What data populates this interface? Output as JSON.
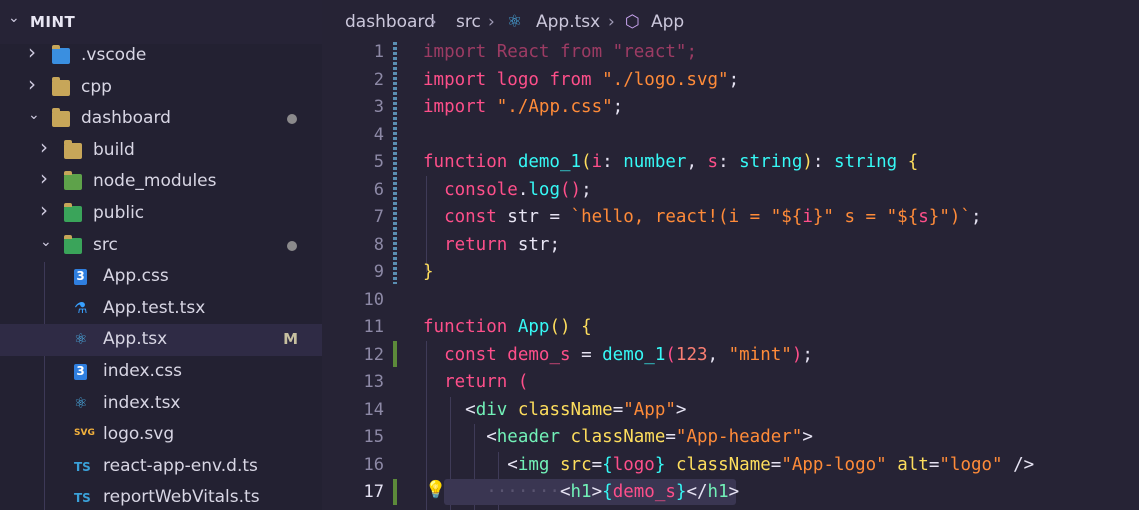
{
  "explorer": {
    "root_label": "MINT",
    "items": [
      {
        "label": ".vscode",
        "depth": 1,
        "expanded": false,
        "icon": "vscode-folder-icon"
      },
      {
        "label": "cpp",
        "depth": 1,
        "expanded": false,
        "icon": "folder-icon"
      },
      {
        "label": "dashboard",
        "depth": 1,
        "expanded": true,
        "icon": "folder-open-icon",
        "badge": "dot"
      },
      {
        "label": "build",
        "depth": 2,
        "expanded": false,
        "icon": "build-folder-icon"
      },
      {
        "label": "node_modules",
        "depth": 2,
        "expanded": false,
        "icon": "node-folder-icon"
      },
      {
        "label": "public",
        "depth": 2,
        "expanded": false,
        "icon": "public-folder-icon"
      },
      {
        "label": "src",
        "depth": 2,
        "expanded": true,
        "icon": "src-folder-icon",
        "badge": "dot"
      },
      {
        "label": "App.css",
        "depth": 3,
        "icon": "css-icon"
      },
      {
        "label": "App.test.tsx",
        "depth": 3,
        "icon": "test-icon"
      },
      {
        "label": "App.tsx",
        "depth": 3,
        "icon": "react-icon",
        "selected": true,
        "status": "M"
      },
      {
        "label": "index.css",
        "depth": 3,
        "icon": "css-icon"
      },
      {
        "label": "index.tsx",
        "depth": 3,
        "icon": "react-icon"
      },
      {
        "label": "logo.svg",
        "depth": 3,
        "icon": "svg-icon"
      },
      {
        "label": "react-app-env.d.ts",
        "depth": 3,
        "icon": "ts-icon"
      },
      {
        "label": "reportWebVitals.ts",
        "depth": 3,
        "icon": "ts-icon"
      }
    ]
  },
  "breadcrumb": {
    "parts": [
      "dashboard",
      "src",
      "App.tsx",
      "App"
    ]
  },
  "editor": {
    "line_numbers": [
      "1",
      "2",
      "3",
      "4",
      "5",
      "6",
      "7",
      "8",
      "9",
      "10",
      "11",
      "12",
      "13",
      "14",
      "15",
      "16",
      "17"
    ],
    "active_line": "17",
    "lines": [
      [
        [
          "imp",
          "import "
        ],
        [
          "imp",
          "React "
        ],
        [
          "imp",
          "from "
        ],
        [
          "imp",
          "\"react\""
        ],
        [
          "imp",
          ";"
        ]
      ],
      [
        [
          "kw2",
          "import "
        ],
        [
          "typ",
          "logo "
        ],
        [
          "kw2",
          "from "
        ],
        [
          "str",
          "\"./logo.svg\""
        ],
        [
          "pl",
          ";"
        ]
      ],
      [
        [
          "kw2",
          "import "
        ],
        [
          "str",
          "\"./App.css\""
        ],
        [
          "pl",
          ";"
        ]
      ],
      [],
      [
        [
          "kw2",
          "function "
        ],
        [
          "fn",
          "demo_1"
        ],
        [
          "brace",
          "("
        ],
        [
          "typ",
          "i"
        ],
        [
          "pl",
          ": "
        ],
        [
          "fn",
          "number"
        ],
        [
          "pl",
          ", "
        ],
        [
          "typ",
          "s"
        ],
        [
          "pl",
          ": "
        ],
        [
          "fn",
          "string"
        ],
        [
          "brace",
          ")"
        ],
        [
          "pl",
          ": "
        ],
        [
          "fn",
          "string "
        ],
        [
          "brace",
          "{"
        ]
      ],
      [
        [
          "pl",
          "  "
        ],
        [
          "kw2",
          "console"
        ],
        [
          "pl",
          "."
        ],
        [
          "fn",
          "log"
        ],
        [
          "brace2",
          "()"
        ],
        [
          "pl",
          ";"
        ]
      ],
      [
        [
          "pl",
          "  "
        ],
        [
          "kw2",
          "const "
        ],
        [
          "var",
          "str "
        ],
        [
          "pl",
          "= "
        ],
        [
          "str",
          "`hello, react!(i = \"${"
        ],
        [
          "kw2",
          "i"
        ],
        [
          "str",
          "}\" s = \"${"
        ],
        [
          "kw2",
          "s"
        ],
        [
          "str",
          "}\")`"
        ],
        [
          "pl",
          ";"
        ]
      ],
      [
        [
          "pl",
          "  "
        ],
        [
          "kw2",
          "return "
        ],
        [
          "var",
          "str"
        ],
        [
          "pl",
          ";"
        ]
      ],
      [
        [
          "brace",
          "}"
        ]
      ],
      [],
      [
        [
          "kw2",
          "function "
        ],
        [
          "fn",
          "App"
        ],
        [
          "brace",
          "()"
        ],
        [
          "pl",
          " "
        ],
        [
          "brace",
          "{"
        ]
      ],
      [
        [
          "pl",
          "  "
        ],
        [
          "kw2",
          "const "
        ],
        [
          "typ",
          "demo_s "
        ],
        [
          "pl",
          "= "
        ],
        [
          "fn",
          "demo_1"
        ],
        [
          "brace2",
          "("
        ],
        [
          "num",
          "123"
        ],
        [
          "pl",
          ", "
        ],
        [
          "str",
          "\"mint\""
        ],
        [
          "brace2",
          ")"
        ],
        [
          "pl",
          ";"
        ]
      ],
      [
        [
          "pl",
          "  "
        ],
        [
          "kw2",
          "return "
        ],
        [
          "brace2",
          "("
        ]
      ],
      [
        [
          "pl",
          "    "
        ],
        [
          "pl",
          "<"
        ],
        [
          "tag",
          "div "
        ],
        [
          "attr",
          "className"
        ],
        [
          "pl",
          "="
        ],
        [
          "str",
          "\"App\""
        ],
        [
          "pl",
          ">"
        ]
      ],
      [
        [
          "pl",
          "      "
        ],
        [
          "pl",
          "<"
        ],
        [
          "tag",
          "header "
        ],
        [
          "attr",
          "className"
        ],
        [
          "pl",
          "="
        ],
        [
          "str",
          "\"App-header\""
        ],
        [
          "pl",
          ">"
        ]
      ],
      [
        [
          "pl",
          "        "
        ],
        [
          "pl",
          "<"
        ],
        [
          "tag",
          "img "
        ],
        [
          "attr",
          "src"
        ],
        [
          "pl",
          "="
        ],
        [
          "fn",
          "{"
        ],
        [
          "typ",
          "logo"
        ],
        [
          "fn",
          "} "
        ],
        [
          "attr",
          "className"
        ],
        [
          "pl",
          "="
        ],
        [
          "str",
          "\"App-logo\" "
        ],
        [
          "attr",
          "alt"
        ],
        [
          "pl",
          "="
        ],
        [
          "str",
          "\"logo\" "
        ],
        [
          "pl",
          "/>"
        ]
      ],
      [
        [
          "ws",
          "      ·······"
        ],
        [
          "pl",
          "<"
        ],
        [
          "tag",
          "h1"
        ],
        [
          "pl",
          ">"
        ],
        [
          "fn",
          "{"
        ],
        [
          "typ",
          "demo_s"
        ],
        [
          "fn",
          "}"
        ],
        [
          "pl",
          "</"
        ],
        [
          "tag",
          "h1"
        ],
        [
          "pl",
          ">"
        ]
      ]
    ]
  }
}
